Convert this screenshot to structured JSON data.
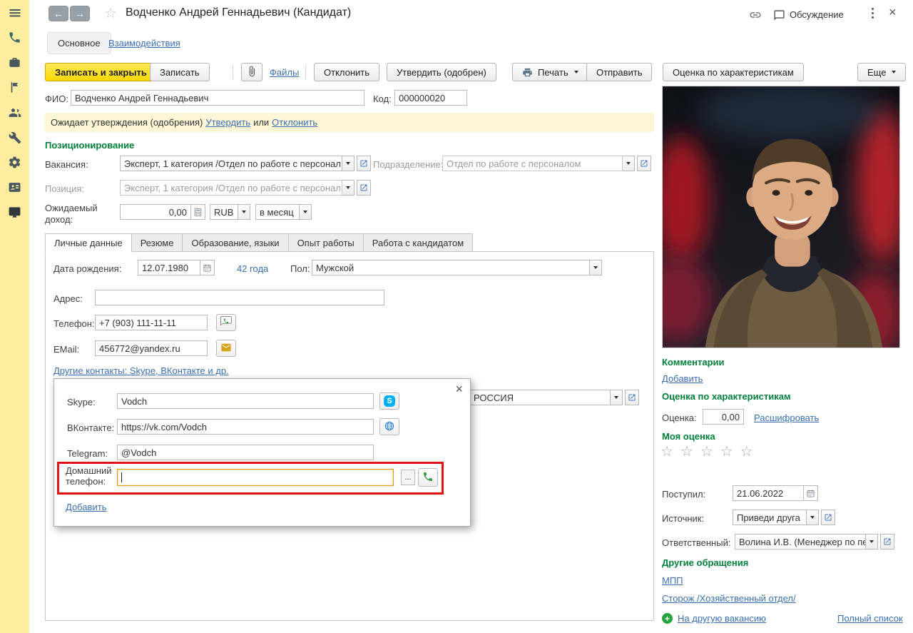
{
  "app": {
    "title": "Водченко Андрей Геннадьевич (Кандидат)",
    "discussion": "Обсуждение"
  },
  "nav": {
    "tab_main": "Основное",
    "tab_interactions": "Взаимодействия"
  },
  "toolbar": {
    "save_and_close": "Записать и закрыть",
    "save": "Записать",
    "files": "Файлы",
    "reject": "Отклонить",
    "approve": "Утвердить (одобрен)",
    "print": "Печать",
    "send": "Отправить",
    "rating": "Оценка по характеристикам",
    "more": "Еще"
  },
  "header_fields": {
    "fio_label": "ФИО:",
    "fio": "Водченко Андрей Геннадьевич",
    "code_label": "Код:",
    "code": "000000020"
  },
  "status_bar": {
    "text": "Ожидает утверждения (одобрения)",
    "approve_link": "Утвердить",
    "or": "или",
    "reject_link": "Отклонить"
  },
  "positioning": {
    "header": "Позиционирование",
    "vacancy_label": "Вакансия:",
    "vacancy": "Эксперт, 1 категория /Отдел по работе с персонал",
    "department_label": "Подразделение:",
    "department": "Отдел по работе с персоналом",
    "position_label": "Позиция:",
    "position": "Эксперт, 1 категория /Отдел по работе с персонал",
    "income_label": "Ожидаемый доход:",
    "income": "0,00",
    "currency": "RUB",
    "period": "в месяц"
  },
  "tabs": {
    "items": [
      "Личные данные",
      "Резюме",
      "Образование, языки",
      "Опыт работы",
      "Работа с кандидатом"
    ]
  },
  "personal": {
    "birth_label": "Дата рождения:",
    "birth_date": "12.07.1980",
    "age": "42 года",
    "gender_label": "Пол:",
    "gender": "Мужской",
    "address_label": "Адрес:",
    "address": "",
    "phone_label": "Телефон:",
    "phone": "+7 (903) 111-11-11",
    "email_label": "EMail:",
    "email": "456772@yandex.ru",
    "other_contacts_link": "Другие контакты: Skype, ВКонтакте и др.",
    "country": "РОССИЯ"
  },
  "contacts_popup": {
    "skype_label": "Skype:",
    "skype": "Vodch",
    "vk_label": "ВКонтакте:",
    "vk": "https://vk.com/Vodch",
    "telegram_label": "Telegram:",
    "telegram": "@Vodch",
    "home_phone_label": "Домашний телефон:",
    "home_phone": "",
    "more_button": "...",
    "add_link": "Добавить"
  },
  "right_panel": {
    "comments_header": "Комментарии",
    "add_link": "Добавить",
    "rating_header": "Оценка по характеристикам",
    "rating_label": "Оценка:",
    "rating_value": "0,00",
    "decode_link": "Расшифровать",
    "my_rating_header": "Моя оценка",
    "received_label": "Поступил:",
    "received_date": "21.06.2022",
    "source_label": "Источник:",
    "source": "Приведи друга",
    "responsible_label": "Ответственный:",
    "responsible": "Волина И.В. (Менеджер по пер",
    "other_applications_header": "Другие обращения",
    "mpp_link": "МПП",
    "watchman_link": "Сторож /Хозяйственный отдел/",
    "to_other_vacancy_link": "На другую вакансию",
    "full_list_link": "Полный список"
  },
  "icons": {
    "sidebar": [
      "menu-icon",
      "phone-icon",
      "briefcase-icon",
      "flag-icon",
      "people-icon",
      "wrench-icon",
      "gear-icon",
      "contacts-icon",
      "monitor-icon"
    ]
  },
  "colors": {
    "sidebar_yellow": "#fcee9e",
    "primary_yellow": "#fcd800",
    "green_header": "#00813a",
    "link_blue": "#3a6fb4",
    "annotation_red": "#e01313",
    "focus_orange": "#e39a00",
    "status_bg": "#fdf7d7"
  }
}
